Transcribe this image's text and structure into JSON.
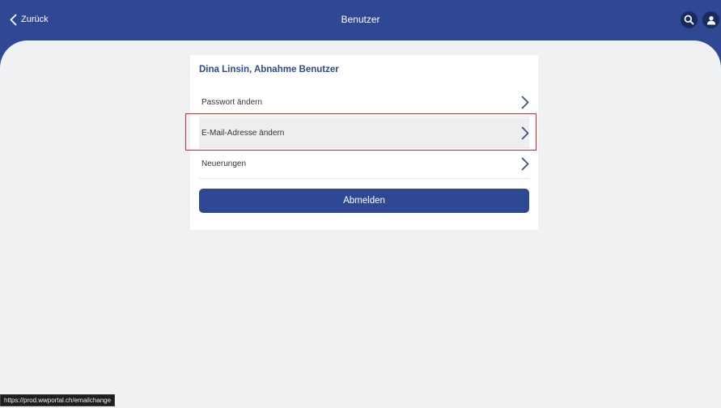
{
  "header": {
    "back_label": "Zurück",
    "title": "Benutzer",
    "search_icon": "search-icon",
    "user_icon": "user-icon"
  },
  "card": {
    "heading": "Dina Linsin, Abnahme Benutzer",
    "items": [
      {
        "label": "Passwort ändern"
      },
      {
        "label": "E-Mail-Adresse ändern"
      },
      {
        "label": "Neuerungen"
      }
    ],
    "logout_label": "Abmelden"
  },
  "status_bar": {
    "url": "https://prod.wwportal.ch/emailchange"
  },
  "colors": {
    "primary": "#2f4894",
    "background": "#eff1f2",
    "highlight": "#e0262a"
  }
}
